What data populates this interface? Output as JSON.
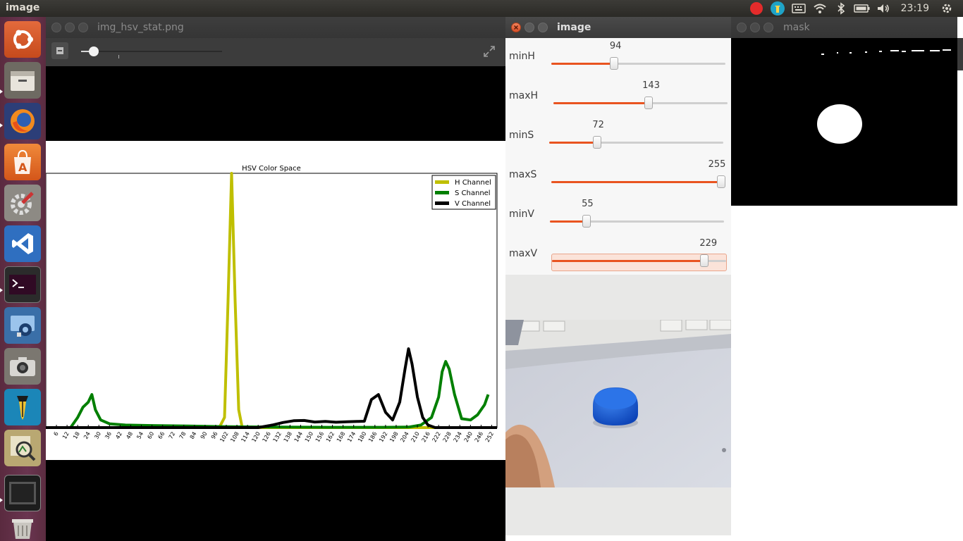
{
  "top_panel": {
    "app_title": "image",
    "clock": "23:19",
    "indicators": [
      "record-icon",
      "app-indicator-icon",
      "keyboard-icon",
      "wifi-icon",
      "bluetooth-icon",
      "battery-icon",
      "volume-icon"
    ]
  },
  "launcher": {
    "items": [
      "ubuntu-dash-icon",
      "files-icon",
      "firefox-icon",
      "software-center-icon",
      "system-settings-icon",
      "vscode-icon",
      "terminal-icon",
      "screen-recorder-icon",
      "camera-icon",
      "pen-icon",
      "image-viewer-icon",
      "workspace-icon",
      "trash-icon"
    ]
  },
  "stat_window": {
    "title": "img_hsv_stat.png",
    "zoom_fraction": 0.09
  },
  "chart_data": {
    "type": "line",
    "title": "HSV Color Space",
    "x_ticks": [
      "6",
      "12",
      "18",
      "24",
      "30",
      "36",
      "42",
      "48",
      "54",
      "60",
      "66",
      "72",
      "78",
      "84",
      "90",
      "96",
      "102",
      "108",
      "114",
      "120",
      "126",
      "132",
      "138",
      "144",
      "150",
      "156",
      "162",
      "168",
      "174",
      "180",
      "186",
      "192",
      "198",
      "204",
      "210",
      "216",
      "222",
      "228",
      "234",
      "240",
      "246",
      "252"
    ],
    "xlim": [
      0,
      255
    ],
    "ylim": [
      0,
      1
    ],
    "legend_position": "upper-right",
    "series": [
      {
        "name": "H Channel",
        "color": "#bfbf00",
        "points": [
          [
            0,
            0
          ],
          [
            98,
            0
          ],
          [
            101,
            0.04
          ],
          [
            103,
            0.5
          ],
          [
            105,
            1.0
          ],
          [
            107,
            0.5
          ],
          [
            109,
            0.07
          ],
          [
            111,
            0
          ],
          [
            255,
            0
          ]
        ]
      },
      {
        "name": "S Channel",
        "color": "#007f00",
        "points": [
          [
            0,
            0
          ],
          [
            14,
            0
          ],
          [
            18,
            0.04
          ],
          [
            21,
            0.08
          ],
          [
            24,
            0.1
          ],
          [
            26,
            0.13
          ],
          [
            28,
            0.07
          ],
          [
            31,
            0.03
          ],
          [
            36,
            0.015
          ],
          [
            45,
            0.01
          ],
          [
            60,
            0.008
          ],
          [
            80,
            0.006
          ],
          [
            100,
            0.004
          ],
          [
            130,
            0.002
          ],
          [
            160,
            0.001
          ],
          [
            190,
            0.001
          ],
          [
            205,
            0.002
          ],
          [
            212,
            0.01
          ],
          [
            218,
            0.04
          ],
          [
            222,
            0.12
          ],
          [
            224,
            0.22
          ],
          [
            226,
            0.26
          ],
          [
            228,
            0.23
          ],
          [
            231,
            0.13
          ],
          [
            235,
            0.035
          ],
          [
            240,
            0.03
          ],
          [
            244,
            0.05
          ],
          [
            248,
            0.09
          ],
          [
            250,
            0.13
          ]
        ]
      },
      {
        "name": "V Channel",
        "color": "#000000",
        "points": [
          [
            0,
            0
          ],
          [
            120,
            0
          ],
          [
            128,
            0.01
          ],
          [
            134,
            0.02
          ],
          [
            140,
            0.027
          ],
          [
            146,
            0.028
          ],
          [
            152,
            0.022
          ],
          [
            158,
            0.024
          ],
          [
            164,
            0.021
          ],
          [
            170,
            0.023
          ],
          [
            176,
            0.024
          ],
          [
            180,
            0.025
          ],
          [
            184,
            0.11
          ],
          [
            188,
            0.13
          ],
          [
            192,
            0.06
          ],
          [
            196,
            0.03
          ],
          [
            200,
            0.1
          ],
          [
            203,
            0.23
          ],
          [
            205,
            0.31
          ],
          [
            207,
            0.25
          ],
          [
            210,
            0.12
          ],
          [
            213,
            0.04
          ],
          [
            216,
            0.01
          ],
          [
            220,
            0
          ],
          [
            255,
            0
          ]
        ]
      }
    ]
  },
  "image_window": {
    "title": "image",
    "sliders": [
      {
        "label": "minH",
        "value": "94",
        "fraction": 0.369
      },
      {
        "label": "maxH",
        "value": "143",
        "fraction": 0.561
      },
      {
        "label": "minS",
        "value": "72",
        "fraction": 0.282
      },
      {
        "label": "maxS",
        "value": "255",
        "fraction": 1.0
      },
      {
        "label": "minV",
        "value": "55",
        "fraction": 0.216
      },
      {
        "label": "maxV",
        "value": "229",
        "fraction": 0.898
      }
    ]
  },
  "mask_window": {
    "title": "mask"
  }
}
